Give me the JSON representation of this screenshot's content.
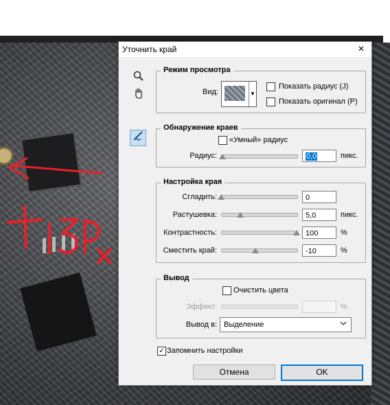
{
  "background": {
    "annotation_text": "+15px"
  },
  "dialog": {
    "title": "Уточнить край",
    "close_icon": "×",
    "tools": [
      "zoom-icon",
      "hand-icon",
      "refine-brush-icon"
    ],
    "view_mode": {
      "title": "Режим просмотра",
      "view_label": "Вид:",
      "show_radius_label": "Показать радиус (J)",
      "show_original_label": "Показать оригинал (P)"
    },
    "edge_detection": {
      "title": "Обнаружение краев",
      "smart_radius_label": "«Умный» радиус",
      "radius_label": "Радиус:",
      "radius_value": "0,0",
      "radius_unit": "пикс."
    },
    "adjust_edge": {
      "title": "Настройка края",
      "smooth_label": "Сгладить:",
      "smooth_value": "0",
      "feather_label": "Растушевка:",
      "feather_value": "5,0",
      "feather_unit": "пикс.",
      "contrast_label": "Контрастность:",
      "contrast_value": "100",
      "contrast_unit": "%",
      "shift_label": "Сместить край:",
      "shift_value": "-10",
      "shift_unit": "%",
      "slider_levels": {
        "smooth": 0.0,
        "feather": 0.25,
        "contrast": 1.0,
        "shift": 0.45
      }
    },
    "output": {
      "title": "Вывод",
      "decontaminate_label": "Очистить цвета",
      "effect_label": "Эффект:",
      "effect_unit": "%",
      "output_to_label": "Вывод в:",
      "output_to_value": "Выделение"
    },
    "remember_label": "Запомнить настройки",
    "remember_checked": true,
    "cancel_label": "Отмена",
    "ok_label": "OK"
  },
  "colors": {
    "accent": "#0078d7",
    "annotation_red": "#e8202a"
  }
}
